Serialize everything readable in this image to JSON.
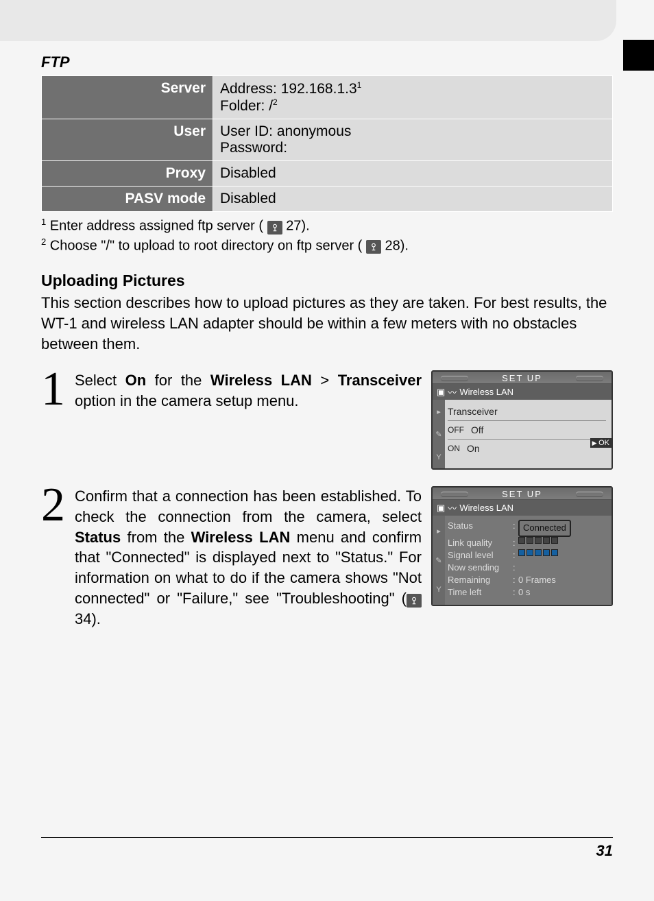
{
  "heading": "FTP",
  "table": {
    "server_label": "Server",
    "server_line1": "Address: 192.168.1.3",
    "server_fn1": "1",
    "server_line2": "Folder: /",
    "server_fn2": "2",
    "user_label": "User",
    "user_line1": "User ID: anonymous",
    "user_line2": "Password:",
    "proxy_label": "Proxy",
    "proxy_value": "Disabled",
    "pasv_label": "PASV mode",
    "pasv_value": "Disabled"
  },
  "footnotes": {
    "n1_num": "1",
    "n1_text_a": "Enter address assigned ftp server (",
    "n1_ref": "27",
    "n1_text_b": ").",
    "n2_num": "2",
    "n2_text_a": "Choose \"/\" to upload to root directory on ftp server (",
    "n2_ref": "28",
    "n2_text_b": ")."
  },
  "section_title": "Uploading Pictures",
  "intro": "This section describes how to upload pictures as they are taken.  For best results, the WT-1 and wireless LAN adapter should be within a few meters with no obstacles between them.",
  "step1": {
    "num": "1",
    "a": "Select ",
    "on": "On",
    "b": " for the ",
    "menu": "Wireless LAN",
    "gt": " > ",
    "opt": "Transceiver",
    "c": " option in the camera setup menu."
  },
  "step2": {
    "num": "2",
    "text_a": "Confirm that a connection has been established. To check the connection from the camera, select ",
    "status": "Status",
    "text_b": " from the ",
    "menu": "Wireless LAN",
    "text_c": " menu and confirm that \"Connected\" is displayed next to \"Status.\"  For information on what to do if the camera shows \"Not connected\" or \"Failure,\" see \"Troubleshooting\" (",
    "ref": "34",
    "text_d": ")."
  },
  "lcd1": {
    "title": "SET  UP",
    "subtitle": "Wireless LAN",
    "heading": "Transceiver",
    "off_code": "OFF",
    "off_label": "Off",
    "on_code": "ON",
    "on_label": "On",
    "ok": "OK"
  },
  "lcd2": {
    "title": "SET  UP",
    "subtitle": "Wireless LAN",
    "rows": {
      "status_k": "Status",
      "status_v": "Connected",
      "link_k": "Link quality",
      "signal_k": "Signal level",
      "sending_k": "Now sending",
      "remaining_k": "Remaining",
      "remaining_v": "0 Frames",
      "timeleft_k": "Time left",
      "timeleft_v": "0 s"
    }
  },
  "page_number": "31"
}
